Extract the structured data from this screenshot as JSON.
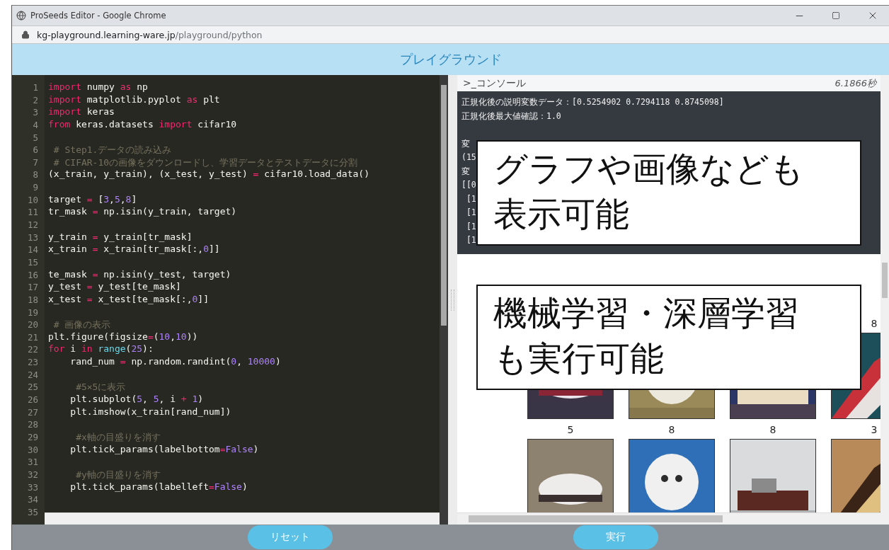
{
  "browser": {
    "title": "ProSeeds Editor - Google Chrome",
    "url_host": "kg-playground.learning-ware.jp",
    "url_path": "/playground/python"
  },
  "header": {
    "title": "プレイグラウンド"
  },
  "editor": {
    "lines": [
      {
        "n": "1",
        "tokens": [
          {
            "text": "import",
            "kind": "kw"
          },
          {
            "text": " numpy ",
            "kind": "t"
          },
          {
            "text": "as",
            "kind": "kw"
          },
          {
            "text": " np",
            "kind": "t"
          }
        ]
      },
      {
        "n": "2",
        "tokens": [
          {
            "text": "import",
            "kind": "kw"
          },
          {
            "text": " matplotlib.pyplot ",
            "kind": "t"
          },
          {
            "text": "as",
            "kind": "kw"
          },
          {
            "text": " plt",
            "kind": "t"
          }
        ]
      },
      {
        "n": "3",
        "tokens": [
          {
            "text": "import",
            "kind": "kw"
          },
          {
            "text": " keras",
            "kind": "t"
          }
        ]
      },
      {
        "n": "4",
        "tokens": [
          {
            "text": "from",
            "kind": "kw"
          },
          {
            "text": " keras.datasets ",
            "kind": "t"
          },
          {
            "text": "import",
            "kind": "kw"
          },
          {
            "text": " cifar10",
            "kind": "t"
          }
        ]
      },
      {
        "n": "5"
      },
      {
        "n": "6",
        "tokens": [
          {
            "text": " # Step1.データの読み込み",
            "kind": "cm"
          }
        ]
      },
      {
        "n": "7",
        "tokens": [
          {
            "text": " # CIFAR-10の画像をダウンロードし、学習データとテストデータに分割",
            "kind": "cm"
          }
        ]
      },
      {
        "n": "8",
        "tokens": [
          {
            "text": "(x_train, y_train), (x_test, y_test) ",
            "kind": "t"
          },
          {
            "text": "=",
            "kind": "op"
          },
          {
            "text": " cifar10.load_data()",
            "kind": "t"
          }
        ]
      },
      {
        "n": "9"
      },
      {
        "n": "10",
        "tokens": [
          {
            "text": "target ",
            "kind": "t"
          },
          {
            "text": "=",
            "kind": "op"
          },
          {
            "text": " [",
            "kind": "t"
          },
          {
            "text": "3",
            "kind": "num"
          },
          {
            "text": ",",
            "kind": "t"
          },
          {
            "text": "5",
            "kind": "num"
          },
          {
            "text": ",",
            "kind": "t"
          },
          {
            "text": "8",
            "kind": "num"
          },
          {
            "text": "]",
            "kind": "t"
          }
        ]
      },
      {
        "n": "11",
        "tokens": [
          {
            "text": "tr_mask ",
            "kind": "t"
          },
          {
            "text": "=",
            "kind": "op"
          },
          {
            "text": " np.isin(y_train, target)",
            "kind": "t"
          }
        ]
      },
      {
        "n": "12"
      },
      {
        "n": "13",
        "tokens": [
          {
            "text": "y_train ",
            "kind": "t"
          },
          {
            "text": "=",
            "kind": "op"
          },
          {
            "text": " y_train[tr_mask]",
            "kind": "t"
          }
        ]
      },
      {
        "n": "14",
        "tokens": [
          {
            "text": "x_train ",
            "kind": "t"
          },
          {
            "text": "=",
            "kind": "op"
          },
          {
            "text": " x_train[tr_mask[:,",
            "kind": "t"
          },
          {
            "text": "0",
            "kind": "num"
          },
          {
            "text": "]]",
            "kind": "t"
          }
        ]
      },
      {
        "n": "15"
      },
      {
        "n": "16",
        "tokens": [
          {
            "text": "te_mask ",
            "kind": "t"
          },
          {
            "text": "=",
            "kind": "op"
          },
          {
            "text": " np.isin(y_test, target)",
            "kind": "t"
          }
        ]
      },
      {
        "n": "17",
        "tokens": [
          {
            "text": "y_test ",
            "kind": "t"
          },
          {
            "text": "=",
            "kind": "op"
          },
          {
            "text": " y_test[te_mask]",
            "kind": "t"
          }
        ]
      },
      {
        "n": "18",
        "tokens": [
          {
            "text": "x_test ",
            "kind": "t"
          },
          {
            "text": "=",
            "kind": "op"
          },
          {
            "text": " x_test[te_mask[:,",
            "kind": "t"
          },
          {
            "text": "0",
            "kind": "num"
          },
          {
            "text": "]]",
            "kind": "t"
          }
        ]
      },
      {
        "n": "19"
      },
      {
        "n": "20",
        "tokens": [
          {
            "text": " # 画像の表示",
            "kind": "cm"
          }
        ]
      },
      {
        "n": "21",
        "tokens": [
          {
            "text": "plt.figure(figsize",
            "kind": "t"
          },
          {
            "text": "=",
            "kind": "op"
          },
          {
            "text": "(",
            "kind": "t"
          },
          {
            "text": "10",
            "kind": "num"
          },
          {
            "text": ",",
            "kind": "t"
          },
          {
            "text": "10",
            "kind": "num"
          },
          {
            "text": "))",
            "kind": "t"
          }
        ]
      },
      {
        "n": "22",
        "tokens": [
          {
            "text": "for",
            "kind": "kw"
          },
          {
            "text": " i ",
            "kind": "t"
          },
          {
            "text": "in ",
            "kind": "kw"
          },
          {
            "text": "range",
            "kind": "fn"
          },
          {
            "text": "(",
            "kind": "t"
          },
          {
            "text": "25",
            "kind": "num"
          },
          {
            "text": "):",
            "kind": "t"
          }
        ]
      },
      {
        "n": "23",
        "tokens": [
          {
            "text": "    rand_num ",
            "kind": "t"
          },
          {
            "text": "=",
            "kind": "op"
          },
          {
            "text": " np.random.randint(",
            "kind": "t"
          },
          {
            "text": "0",
            "kind": "num"
          },
          {
            "text": ", ",
            "kind": "t"
          },
          {
            "text": "10000",
            "kind": "num"
          },
          {
            "text": ")",
            "kind": "t"
          }
        ]
      },
      {
        "n": "24"
      },
      {
        "n": "25",
        "tokens": [
          {
            "text": "     #5×5に表示",
            "kind": "cm"
          }
        ]
      },
      {
        "n": "26",
        "tokens": [
          {
            "text": "    plt.subplot(",
            "kind": "t"
          },
          {
            "text": "5",
            "kind": "num"
          },
          {
            "text": ", ",
            "kind": "t"
          },
          {
            "text": "5",
            "kind": "num"
          },
          {
            "text": ", i ",
            "kind": "t"
          },
          {
            "text": "+",
            "kind": "op"
          },
          {
            "text": " 1",
            "kind": "num"
          },
          {
            "text": ")",
            "kind": "t"
          }
        ]
      },
      {
        "n": "27",
        "tokens": [
          {
            "text": "    plt.imshow(x_train[rand_num])",
            "kind": "t"
          }
        ]
      },
      {
        "n": "28"
      },
      {
        "n": "29",
        "tokens": [
          {
            "text": "     #x軸の目盛りを消す",
            "kind": "cm"
          }
        ]
      },
      {
        "n": "30",
        "tokens": [
          {
            "text": "    plt.tick_params(labelbottom",
            "kind": "t"
          },
          {
            "text": "=",
            "kind": "op"
          },
          {
            "text": "False",
            "kind": "num"
          },
          {
            "text": ")",
            "kind": "t"
          }
        ]
      },
      {
        "n": "31"
      },
      {
        "n": "32",
        "tokens": [
          {
            "text": "     #y軸の目盛りを消す",
            "kind": "cm"
          }
        ]
      },
      {
        "n": "33",
        "tokens": [
          {
            "text": "    plt.tick_params(labelleft",
            "kind": "t"
          },
          {
            "text": "=",
            "kind": "op"
          },
          {
            "text": "False",
            "kind": "num"
          },
          {
            "text": ")",
            "kind": "t"
          }
        ]
      },
      {
        "n": "34"
      },
      {
        "n": "35"
      }
    ]
  },
  "console": {
    "title": ">_コンソール",
    "elapsed": "6.1866秒",
    "output": [
      [
        "正規化後の説明変数データ：[0.5254902 0.7294118 0.8745098]",
        "正規化後最大値確認：1.0"
      ],
      [
        "変",
        "(15",
        "変",
        "[[0",
        " [1",
        " [1",
        " [1",
        " [1"
      ]
    ],
    "figure": {
      "rows": [
        {
          "subplots": [
            {
              "kind": "picture"
            },
            {
              "kind": "picture"
            },
            {
              "kind": "picture"
            },
            {
              "kind": "picture",
              "title": "8"
            }
          ]
        },
        {
          "subplots": [
            {
              "kind": "picture",
              "title": "5"
            },
            {
              "kind": "picture",
              "title": "8"
            },
            {
              "kind": "picture",
              "title": "8"
            },
            {
              "kind": "picture",
              "title": "3"
            }
          ]
        }
      ]
    }
  },
  "callouts": [
    {
      "lines": [
        "グラフや画像なども",
        "表示可能"
      ]
    },
    {
      "lines": [
        "機械学習・深層学習",
        "も実行可能"
      ]
    }
  ],
  "buttons": [
    {
      "label": "リセット"
    },
    {
      "label": "実行"
    }
  ]
}
